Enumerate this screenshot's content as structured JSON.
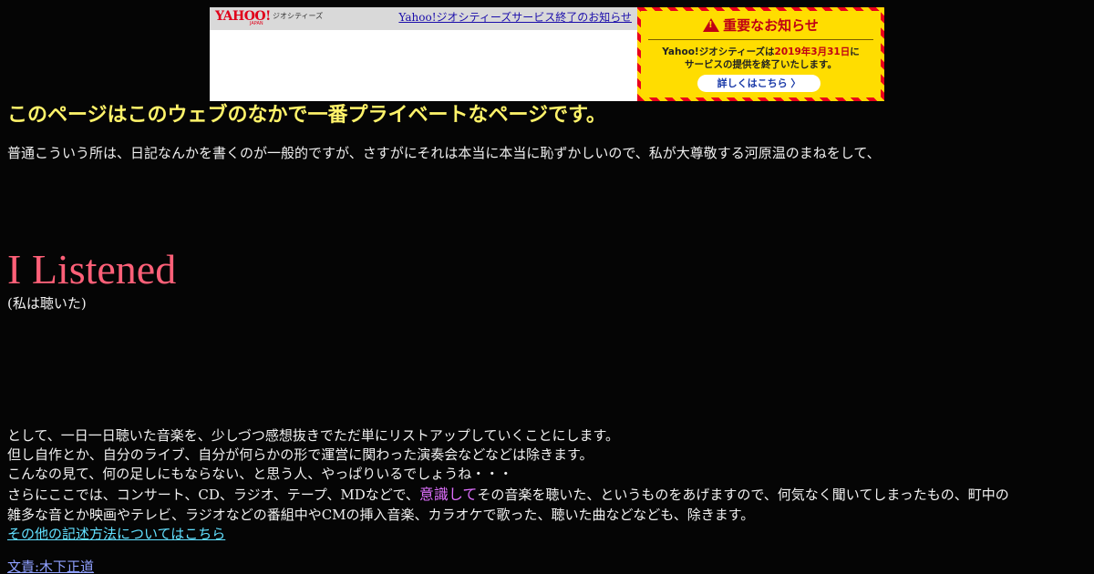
{
  "banner": {
    "logo": "YAHOO!",
    "logo_sub": "JAPAN",
    "service": "ジオシティーズ",
    "link": "Yahoo!ジオシティーズサービス終了のお知らせ"
  },
  "notice": {
    "heading": "重要なお知らせ",
    "line1_pre": "Yahoo!ジオシティーズは",
    "line1_date": "2019年3月31日",
    "line1_post": "に",
    "line2": "サービスの提供を終了いたします。",
    "button": "詳しくはこちら 〉"
  },
  "page": {
    "headline": "このページはこのウェブのなかで一番プライベートなページです。",
    "intro": "普通こういう所は、日記なんかを書くのが一般的ですが、さすがにそれは本当に本当に恥ずかしいので、私が大尊敬する河原温のまねをして、",
    "title": "I Listened",
    "subtitle": "(私は聴いた)",
    "para1": "として、一日一日聴いた音楽を、少しづつ感想抜きでただ単にリストアップしていくことにします。",
    "para2": "但し自作とか、自分のライブ、自分が何らかの形で運営に関わった演奏会などなどは除きます。",
    "para3": "こんなの見て、何の足しにもならない、と思う人、やっぱりいるでしょうね・・・",
    "para4_pre": "さらにここでは、コンサート、CD、ラジオ、テープ、MDなどで、",
    "para4_accent": "意識して",
    "para4_post": "その音楽を聴いた、というものをあげますので、何気なく聞いてしまったもの、町中の",
    "para5": "雑多な音とか映画やテレビ、ラジオなどの番組中やCMの挿入音楽、カラオケで歌った、聴いた曲などなども、除きます。",
    "other_link": "その他の記述方法についてはこちら",
    "author_link": "文責:木下正道"
  },
  "colors": {
    "background": "#050505",
    "headline": "#fff36a",
    "title": "#ff6078",
    "accent": "#e070ff",
    "link": "#62e0ff"
  }
}
